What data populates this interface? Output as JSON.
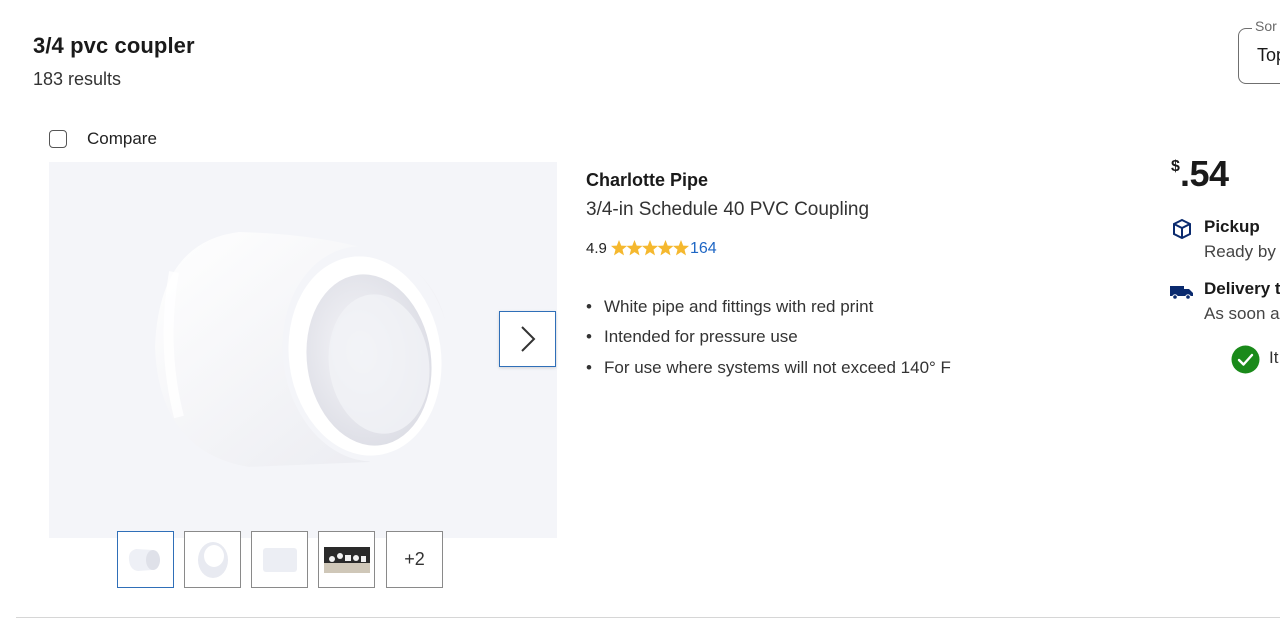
{
  "search": {
    "title": "3/4 pvc coupler",
    "results_count": "183 results"
  },
  "sort": {
    "label": "Sor",
    "value": "Top"
  },
  "compare": {
    "label": "Compare",
    "checked": false
  },
  "product": {
    "brand": "Charlotte Pipe",
    "name": "3/4-in Schedule 40 PVC Coupling",
    "rating": "4.9",
    "stars": 5,
    "review_count": "164",
    "features": [
      "White pipe and fittings with red print",
      "Intended for pressure use",
      "For use where systems will not exceed 140° F"
    ],
    "thumbnails_more": "+2"
  },
  "price": {
    "currency": "$",
    "value": ".54"
  },
  "fulfillment": {
    "pickup_label": "Pickup",
    "pickup_detail": "Ready by",
    "delivery_label": "Delivery to",
    "delivery_detail": "As soon as",
    "availability_text": "It"
  },
  "colors": {
    "accent_blue": "#1e66c4",
    "star_gold": "#f5b82e",
    "navy_icon": "#0a2a6e",
    "success_green": "#1a8a1a"
  }
}
